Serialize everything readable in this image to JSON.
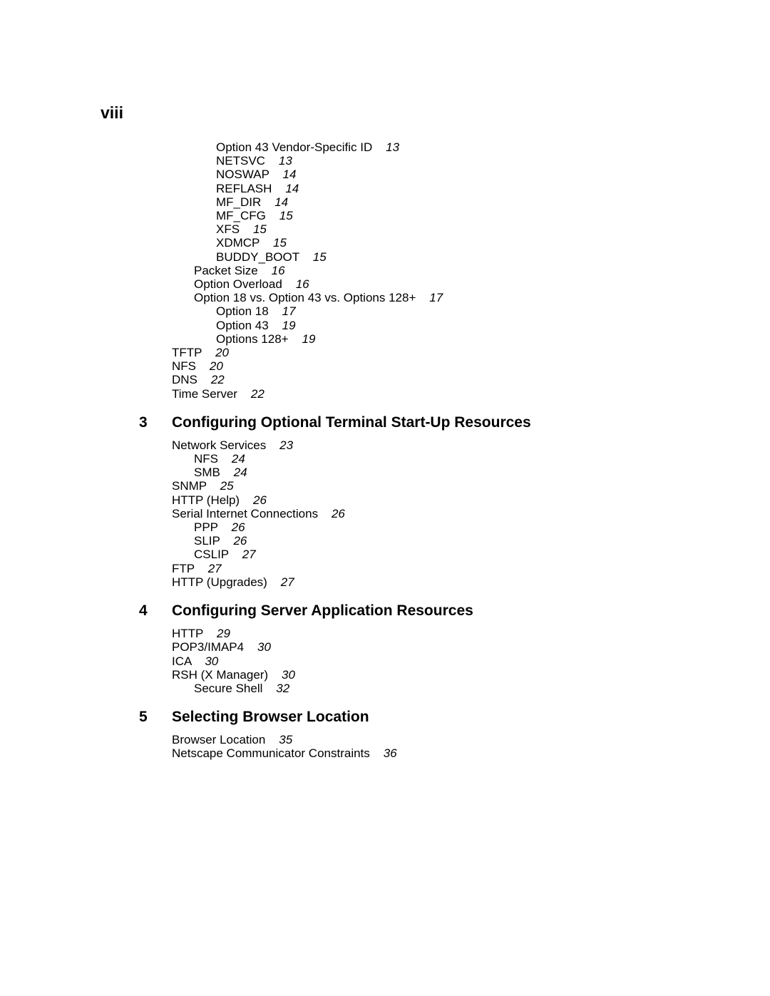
{
  "page_number": "viii",
  "initial_entries": [
    {
      "level": 2,
      "label": "Option 43 Vendor-Specific ID",
      "page": "13"
    },
    {
      "level": 2,
      "label": "NETSVC",
      "page": "13"
    },
    {
      "level": 2,
      "label": "NOSWAP",
      "page": "14"
    },
    {
      "level": 2,
      "label": "REFLASH",
      "page": "14"
    },
    {
      "level": 2,
      "label": "MF_DIR",
      "page": "14"
    },
    {
      "level": 2,
      "label": "MF_CFG",
      "page": "15"
    },
    {
      "level": 2,
      "label": "XFS",
      "page": "15"
    },
    {
      "level": 2,
      "label": "XDMCP",
      "page": "15"
    },
    {
      "level": 2,
      "label": "BUDDY_BOOT",
      "page": "15"
    },
    {
      "level": 1,
      "label": "Packet Size",
      "page": "16"
    },
    {
      "level": 1,
      "label": "Option Overload",
      "page": "16"
    },
    {
      "level": 1,
      "label": "Option 18 vs. Option 43 vs. Options 128+",
      "page": "17"
    },
    {
      "level": 2,
      "label": "Option 18",
      "page": "17"
    },
    {
      "level": 2,
      "label": "Option 43",
      "page": "19"
    },
    {
      "level": 2,
      "label": "Options 128+",
      "page": "19"
    },
    {
      "level": 0,
      "label": "TFTP",
      "page": "20"
    },
    {
      "level": 0,
      "label": "NFS",
      "page": "20"
    },
    {
      "level": 0,
      "label": "DNS",
      "page": "22"
    },
    {
      "level": 0,
      "label": "Time Server",
      "page": "22"
    }
  ],
  "sections": [
    {
      "num": "3",
      "title": "Configuring Optional Terminal Start-Up Resources",
      "entries": [
        {
          "level": 0,
          "label": "Network Services",
          "page": "23"
        },
        {
          "level": 1,
          "label": "NFS",
          "page": "24"
        },
        {
          "level": 1,
          "label": "SMB",
          "page": "24"
        },
        {
          "level": 0,
          "label": "SNMP",
          "page": "25"
        },
        {
          "level": 0,
          "label": "HTTP (Help)",
          "page": "26"
        },
        {
          "level": 0,
          "label": "Serial Internet Connections",
          "page": "26"
        },
        {
          "level": 1,
          "label": "PPP",
          "page": "26"
        },
        {
          "level": 1,
          "label": "SLIP",
          "page": "26"
        },
        {
          "level": 1,
          "label": "CSLIP",
          "page": "27"
        },
        {
          "level": 0,
          "label": "FTP",
          "page": "27"
        },
        {
          "level": 0,
          "label": "HTTP (Upgrades)",
          "page": "27"
        }
      ]
    },
    {
      "num": "4",
      "title": "Configuring Server Application Resources",
      "entries": [
        {
          "level": 0,
          "label": "HTTP",
          "page": "29"
        },
        {
          "level": 0,
          "label": "POP3/IMAP4",
          "page": "30"
        },
        {
          "level": 0,
          "label": "ICA",
          "page": "30"
        },
        {
          "level": 0,
          "label": "RSH (X Manager)",
          "page": "30"
        },
        {
          "level": 1,
          "label": "Secure Shell",
          "page": "32"
        }
      ]
    },
    {
      "num": "5",
      "title": "Selecting Browser Location",
      "entries": [
        {
          "level": 0,
          "label": "Browser Location",
          "page": "35"
        },
        {
          "level": 0,
          "label": "Netscape Communicator Constraints",
          "page": "36"
        }
      ]
    }
  ]
}
